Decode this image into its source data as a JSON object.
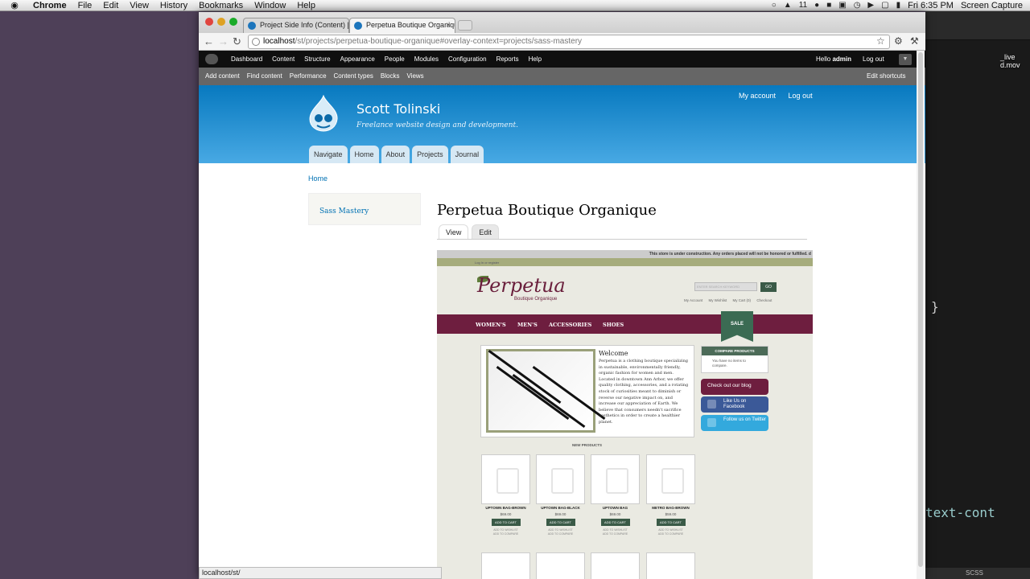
{
  "menubar": {
    "app_name": "Chrome",
    "items": [
      "File",
      "Edit",
      "View",
      "History",
      "Bookmarks",
      "Window",
      "Help"
    ],
    "status_count": "11",
    "clock": "Fri 6:35 PM",
    "capture_label": "Screen Capture"
  },
  "browser": {
    "tabs": [
      {
        "title": "Project Side Info (Content) | S"
      },
      {
        "title": "Perpetua Boutique Organique"
      }
    ],
    "url_host": "localhost",
    "url_path": "/st/projects/perpetua-boutique-organique#overlay-context=projects/sass-mastery",
    "status_url": "localhost/st/"
  },
  "drupal_toolbar": {
    "items": [
      "Dashboard",
      "Content",
      "Structure",
      "Appearance",
      "People",
      "Modules",
      "Configuration",
      "Reports",
      "Help"
    ],
    "hello": "Hello",
    "username": "admin",
    "logout": "Log out"
  },
  "shortcuts": {
    "items": [
      "Add content",
      "Find content",
      "Performance",
      "Content types",
      "Blocks",
      "Views"
    ],
    "edit": "Edit shortcuts"
  },
  "site": {
    "name": "Scott Tolinski",
    "slogan": "Freelance website design and development.",
    "secondary": [
      "My account",
      "Log out"
    ],
    "main_menu": [
      "Navigate",
      "Home",
      "About",
      "Projects",
      "Journal"
    ]
  },
  "page": {
    "breadcrumb": "Home",
    "sidebar_link": "Sass Mastery",
    "title": "Perpetua Boutique Organique",
    "tabs": [
      "View",
      "Edit"
    ]
  },
  "store": {
    "notice": "This store is under construction. Any orders placed will not be honored or fulfilled. d",
    "login": "Log In or register",
    "logo": "Perpetua",
    "logo_sub": "Boutique Organique",
    "search_placeholder": "ENTER SEARCH KEYWORD",
    "go": "GO",
    "account_links": [
      "My Account",
      "My Wishlist",
      "My Cart (0)",
      "Checkout"
    ],
    "nav": [
      "WOMEN'S",
      "MEN'S",
      "ACCESSORIES",
      "SHOES"
    ],
    "sale": "SALE",
    "welcome_title": "Welcome",
    "welcome_text": "Perpetua is a clothing boutique specializing in sustainable, environmentally friendly, organic fashion for women and men. Located in downtown Ann Arbor, we offer quality clothing, accessories, and a rotating stock of curiosities meant to diminish or reverse our negative impact on, and increase our appreciation of Earth. We believe that consumers needn't sacrifice aesthetics in order to create a healthier planet.",
    "compare_title": "COMPARE PRODUCTS",
    "compare_text": "You have no items to compare.",
    "blog": "Check out our blog",
    "facebook": "Like Us on Facebook",
    "twitter": "Follow us on Twitter",
    "new_products": "NEW PRODUCTS",
    "products": [
      {
        "name": "UPTOWN BAG-BROWN",
        "price": "$69.00"
      },
      {
        "name": "UPTOWN BAG-BLACK",
        "price": "$69.00"
      },
      {
        "name": "UPTOWN BAG",
        "price": "$69.00"
      },
      {
        "name": "METRO BAG-BROWN",
        "price": "$59.00"
      }
    ],
    "add_to_cart": "ADD TO CART",
    "add_to_wishlist": "ADD TO WISHLIST",
    "add_to_compare": "ADD TO COMPARE"
  },
  "editor": {
    "brace": "}",
    "snippet": "text-cont",
    "status": "SCSS",
    "file_label_1": "_live",
    "file_label_2": "d.mov"
  },
  "colors": {
    "desktop": "#4e4058",
    "drupal_toolbar": "#0f0f0f",
    "header_top": "#0779bf",
    "link": "#0071b3",
    "store_plum": "#6e1e3f"
  }
}
